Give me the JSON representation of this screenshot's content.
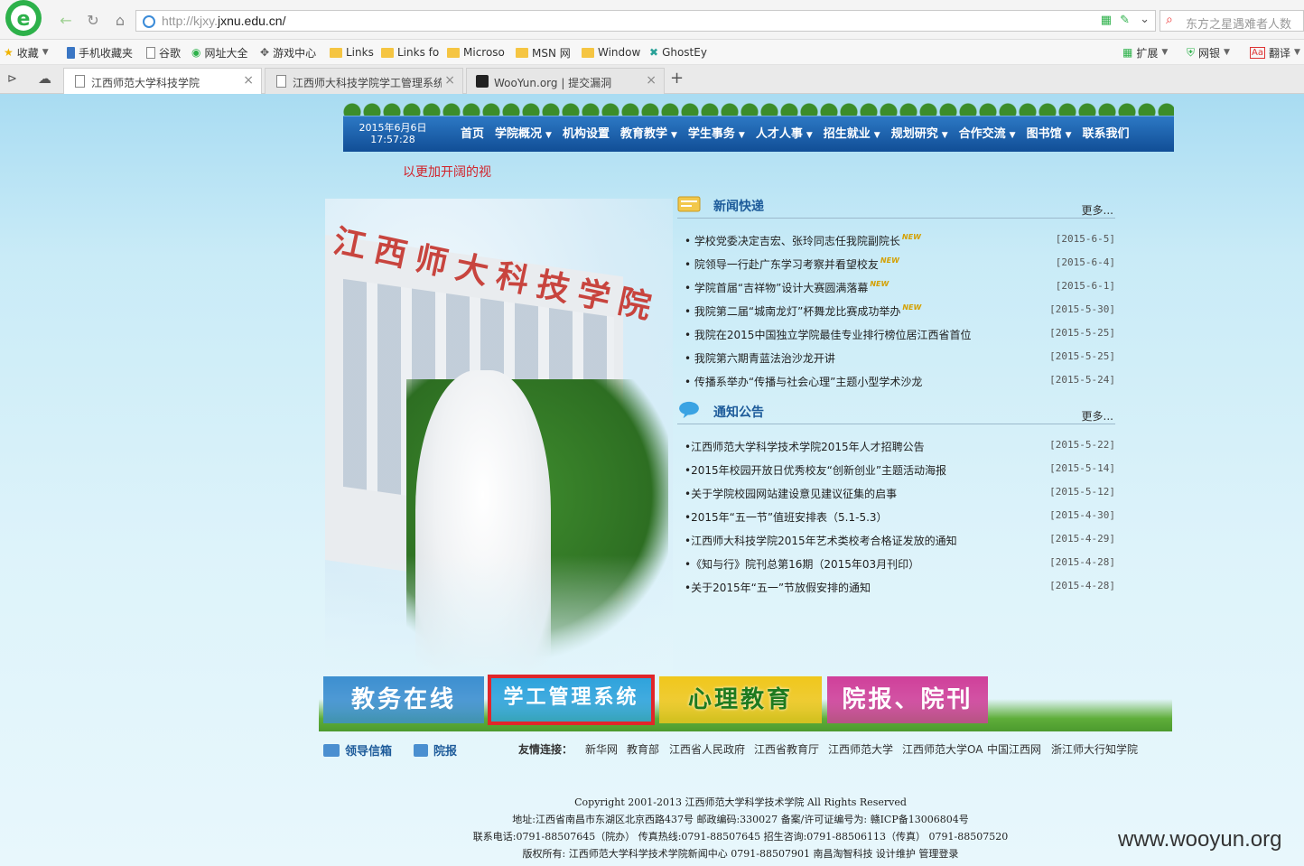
{
  "browser": {
    "url_prefix": "http://kjxy.",
    "url_domain": "jxnu.edu.cn/",
    "search_placeholder": "东方之星遇难者人数",
    "favorites": [
      {
        "label": "收藏"
      },
      {
        "label": "手机收藏夹"
      },
      {
        "label": "谷歌"
      },
      {
        "label": "网址大全"
      },
      {
        "label": "游戏中心"
      },
      {
        "label": "Links"
      },
      {
        "label": "Links fo"
      },
      {
        "label": "Microso"
      },
      {
        "label": "MSN 网"
      },
      {
        "label": "Window"
      },
      {
        "label": "GhostEy"
      }
    ],
    "right_tools": [
      {
        "label": "扩展"
      },
      {
        "label": "网银"
      },
      {
        "label": "翻译"
      }
    ],
    "tabs": [
      {
        "label": "江西师范大学科技学院"
      },
      {
        "label": "江西师大科技学院学工管理系统"
      },
      {
        "label": "WooYun.org | 提交漏洞"
      }
    ]
  },
  "site": {
    "date": "2015年6月6日",
    "time": "17:57:28",
    "nav": [
      {
        "label": "首页"
      },
      {
        "label": "学院概况"
      },
      {
        "label": "机构设置"
      },
      {
        "label": "教育教学"
      },
      {
        "label": "学生事务"
      },
      {
        "label": "人才人事"
      },
      {
        "label": "招生就业"
      },
      {
        "label": "规划研究"
      },
      {
        "label": "合作交流"
      },
      {
        "label": "图书馆"
      },
      {
        "label": "联系我们"
      }
    ],
    "scroll_text": "以更加开阔的视",
    "campus_sign": "江西师大科技学院",
    "news": {
      "title": "新闻快递",
      "more": "更多...",
      "icon": "note-icon",
      "new_tag": "NEW",
      "items": [
        {
          "title": "学校党委决定吉宏、张玲同志任我院副院长",
          "date": "[2015-6-5]"
        },
        {
          "title": "院领导一行赴广东学习考察并看望校友",
          "date": "[2015-6-4]"
        },
        {
          "title": "学院首届“吉祥物”设计大赛圆满落幕",
          "date": "[2015-6-1]"
        },
        {
          "title": "我院第二届“城南龙灯”杯舞龙比赛成功举办",
          "date": "[2015-5-30]"
        },
        {
          "title": "我院在2015中国独立学院最佳专业排行榜位居江西省首位",
          "date": "[2015-5-25]"
        },
        {
          "title": "我院第六期青蓝法治沙龙开讲",
          "date": "[2015-5-25]"
        },
        {
          "title": "传播系举办“传播与社会心理”主题小型学术沙龙",
          "date": "[2015-5-24]"
        }
      ]
    },
    "notice": {
      "title": "通知公告",
      "more": "更多...",
      "icon": "speech-bubble-icon",
      "items": [
        {
          "title": "江西师范大学科学技术学院2015年人才招聘公告",
          "date": "[2015-5-22]"
        },
        {
          "title": "2015年校园开放日优秀校友“创新创业”主题活动海报",
          "date": "[2015-5-14]"
        },
        {
          "title": "关于学院校园网站建设意见建议征集的启事",
          "date": "[2015-5-12]"
        },
        {
          "title": "2015年“五一节”值班安排表（5.1-5.3）",
          "date": "[2015-4-30]"
        },
        {
          "title": "江西师大科技学院2015年艺术类校考合格证发放的通知",
          "date": "[2015-4-29]"
        },
        {
          "title": "《知与行》院刊总第16期（2015年03月刊印）",
          "date": "[2015-4-28]"
        },
        {
          "title": "关于2015年“五一”节放假安排的通知",
          "date": "[2015-4-28]"
        }
      ]
    },
    "banners": [
      {
        "label": "教务在线",
        "color": "#3d8fd0"
      },
      {
        "label": "学工管理系统",
        "color": "#2fa3dc",
        "highlight": "#e0262a"
      },
      {
        "label": "心理教育",
        "color": "#f0c71c"
      },
      {
        "label": "院报、院刊",
        "color": "#d0409a"
      }
    ],
    "links": {
      "leader_mail": "领导信箱",
      "yuanbao": "院报",
      "friend_label": "友情连接：",
      "friends": [
        "新华网",
        "教育部",
        "江西省人民政府",
        "江西省教育厅",
        "江西师范大学",
        "江西师范大学OA",
        "中国江西网",
        "浙江师大行知学院"
      ]
    },
    "footer": [
      "Copyright 2001-2013 江西师范大学科学技术学院  All Rights Reserved",
      "地址:江西省南昌市东湖区北京西路437号   邮政编码:330027   备案/许可证编号为: 赣ICP备13006804号",
      "联系电话:0791-88507645（院办）   传真热线:0791-88507645   招生咨询:0791-88506113（传真）  0791-88507520",
      "版权所有: 江西师范大学科学技术学院新闻中心 0791-88507901 南昌淘智科技 设计维护 管理登录"
    ],
    "watermark": "www.wooyun.org"
  }
}
